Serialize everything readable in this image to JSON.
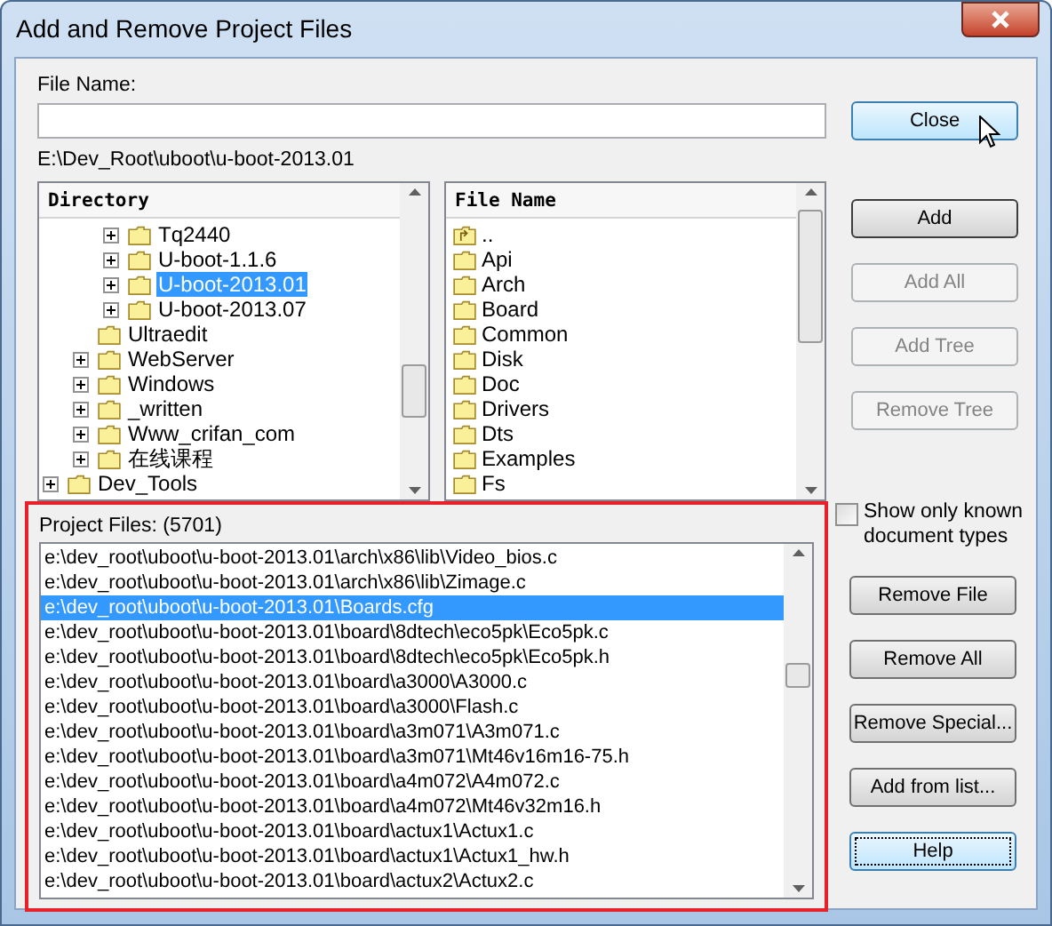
{
  "window": {
    "title": "Add and Remove Project Files"
  },
  "file_name": {
    "label": "File Name:"
  },
  "current_path": "E:\\Dev_Root\\uboot\\u-boot-2013.01",
  "directory": {
    "header": "Directory",
    "items": [
      {
        "children": [
          {
            "children": [
              {
                "label": "Tq2440",
                "expandable": true,
                "selected": false
              },
              {
                "label": "U-boot-1.1.6",
                "expandable": true,
                "selected": false
              },
              {
                "label": "U-boot-2013.01",
                "expandable": true,
                "selected": true
              },
              {
                "label": "U-boot-2013.07",
                "expandable": true,
                "selected": false
              }
            ]
          },
          {
            "label": "Ultraedit",
            "expandable": false,
            "selected": false
          },
          {
            "label": "WebServer",
            "expandable": true,
            "selected": false
          },
          {
            "label": "Windows",
            "expandable": true,
            "selected": false
          },
          {
            "label": "_written",
            "expandable": true,
            "selected": false
          },
          {
            "label": "Www_crifan_com",
            "expandable": true,
            "selected": false
          },
          {
            "label": "在线课程",
            "expandable": true,
            "selected": false
          }
        ]
      },
      {
        "label": "Dev_Tools",
        "expandable": true,
        "selected": false
      }
    ]
  },
  "file_list": {
    "header": "File Name",
    "items": [
      {
        "label": "..",
        "kind": "parent"
      },
      {
        "label": "Api",
        "kind": "folder"
      },
      {
        "label": "Arch",
        "kind": "folder"
      },
      {
        "label": "Board",
        "kind": "folder"
      },
      {
        "label": "Common",
        "kind": "folder"
      },
      {
        "label": "Disk",
        "kind": "folder"
      },
      {
        "label": "Doc",
        "kind": "folder"
      },
      {
        "label": "Drivers",
        "kind": "folder"
      },
      {
        "label": "Dts",
        "kind": "folder"
      },
      {
        "label": "Examples",
        "kind": "folder"
      },
      {
        "label": "Fs",
        "kind": "folder"
      }
    ]
  },
  "top_buttons": [
    {
      "label": "Close",
      "hovered": true,
      "is_default": false,
      "disabled": false
    },
    {
      "label": "Add",
      "hovered": false,
      "is_default": true,
      "disabled": false
    },
    {
      "label": "Add All",
      "hovered": false,
      "is_default": false,
      "disabled": true
    },
    {
      "label": "Add Tree",
      "hovered": false,
      "is_default": false,
      "disabled": true
    },
    {
      "label": "Remove Tree",
      "hovered": false,
      "is_default": false,
      "disabled": true
    }
  ],
  "show_known_types": {
    "label": "Show only known document types",
    "checked": false
  },
  "project_files": {
    "label": "Project Files: (5701)",
    "rows": [
      {
        "path": "e:\\dev_root\\uboot\\u-boot-2013.01\\arch\\x86\\lib\\Video_bios.c",
        "selected": false
      },
      {
        "path": "e:\\dev_root\\uboot\\u-boot-2013.01\\arch\\x86\\lib\\Zimage.c",
        "selected": false
      },
      {
        "path": "e:\\dev_root\\uboot\\u-boot-2013.01\\Boards.cfg",
        "selected": true
      },
      {
        "path": "e:\\dev_root\\uboot\\u-boot-2013.01\\board\\8dtech\\eco5pk\\Eco5pk.c",
        "selected": false
      },
      {
        "path": "e:\\dev_root\\uboot\\u-boot-2013.01\\board\\8dtech\\eco5pk\\Eco5pk.h",
        "selected": false
      },
      {
        "path": "e:\\dev_root\\uboot\\u-boot-2013.01\\board\\a3000\\A3000.c",
        "selected": false
      },
      {
        "path": "e:\\dev_root\\uboot\\u-boot-2013.01\\board\\a3000\\Flash.c",
        "selected": false
      },
      {
        "path": "e:\\dev_root\\uboot\\u-boot-2013.01\\board\\a3m071\\A3m071.c",
        "selected": false
      },
      {
        "path": "e:\\dev_root\\uboot\\u-boot-2013.01\\board\\a3m071\\Mt46v16m16-75.h",
        "selected": false
      },
      {
        "path": "e:\\dev_root\\uboot\\u-boot-2013.01\\board\\a4m072\\A4m072.c",
        "selected": false
      },
      {
        "path": "e:\\dev_root\\uboot\\u-boot-2013.01\\board\\a4m072\\Mt46v32m16.h",
        "selected": false
      },
      {
        "path": "e:\\dev_root\\uboot\\u-boot-2013.01\\board\\actux1\\Actux1.c",
        "selected": false
      },
      {
        "path": "e:\\dev_root\\uboot\\u-boot-2013.01\\board\\actux1\\Actux1_hw.h",
        "selected": false
      },
      {
        "path": "e:\\dev_root\\uboot\\u-boot-2013.01\\board\\actux2\\Actux2.c",
        "selected": false
      }
    ]
  },
  "bottom_buttons": [
    {
      "label": "Remove File",
      "focused": false
    },
    {
      "label": "Remove All",
      "focused": false
    },
    {
      "label": "Remove Special...",
      "focused": false
    },
    {
      "label": "Add from list...",
      "focused": false
    },
    {
      "label": "Help",
      "focused": true
    }
  ]
}
